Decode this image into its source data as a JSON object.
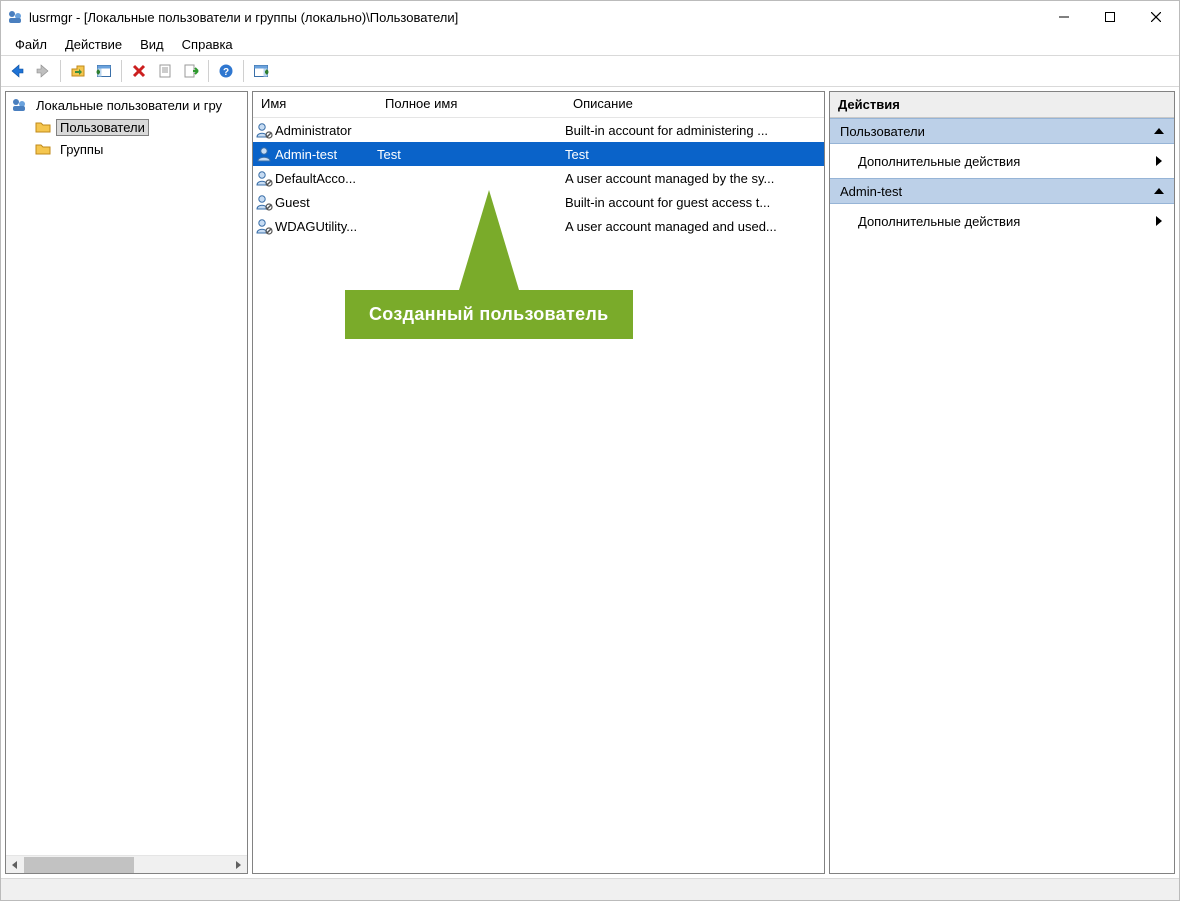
{
  "window": {
    "title": "lusrmgr - [Локальные пользователи и группы (локально)\\Пользователи]"
  },
  "menubar": {
    "items": [
      "Файл",
      "Действие",
      "Вид",
      "Справка"
    ]
  },
  "toolbar": {
    "icons": [
      "back-icon",
      "forward-icon",
      "up-icon",
      "show-hide-tree-icon",
      "delete-icon",
      "properties-icon",
      "export-icon",
      "help-icon",
      "action-pane-icon"
    ]
  },
  "navTree": {
    "root": {
      "label": "Локальные пользователи и гру",
      "icon": "console-root-icon"
    },
    "children": [
      {
        "label": "Пользователи",
        "icon": "folder-icon",
        "selected": true
      },
      {
        "label": "Группы",
        "icon": "folder-icon",
        "selected": false
      }
    ]
  },
  "list": {
    "columns": {
      "name": "Имя",
      "fullName": "Полное имя",
      "description": "Описание"
    },
    "rows": [
      {
        "name": "Administrator",
        "fullName": "",
        "description": "Built-in account for administering ...",
        "selected": false,
        "disabled": true
      },
      {
        "name": "Admin-test",
        "fullName": "Test",
        "description": "Test",
        "selected": true,
        "disabled": false
      },
      {
        "name": "DefaultAcco...",
        "fullName": "",
        "description": "A user account managed by the sy...",
        "selected": false,
        "disabled": true
      },
      {
        "name": "Guest",
        "fullName": "",
        "description": "Built-in account for guest access t...",
        "selected": false,
        "disabled": true
      },
      {
        "name": "WDAGUtility...",
        "fullName": "",
        "description": "A user account managed and used...",
        "selected": false,
        "disabled": true
      }
    ]
  },
  "actions": {
    "header": "Действия",
    "groups": [
      {
        "title": "Пользователи",
        "items": [
          "Дополнительные действия"
        ]
      },
      {
        "title": "Admin-test",
        "items": [
          "Дополнительные действия"
        ]
      }
    ]
  },
  "callout": {
    "text": "Созданный пользователь"
  }
}
